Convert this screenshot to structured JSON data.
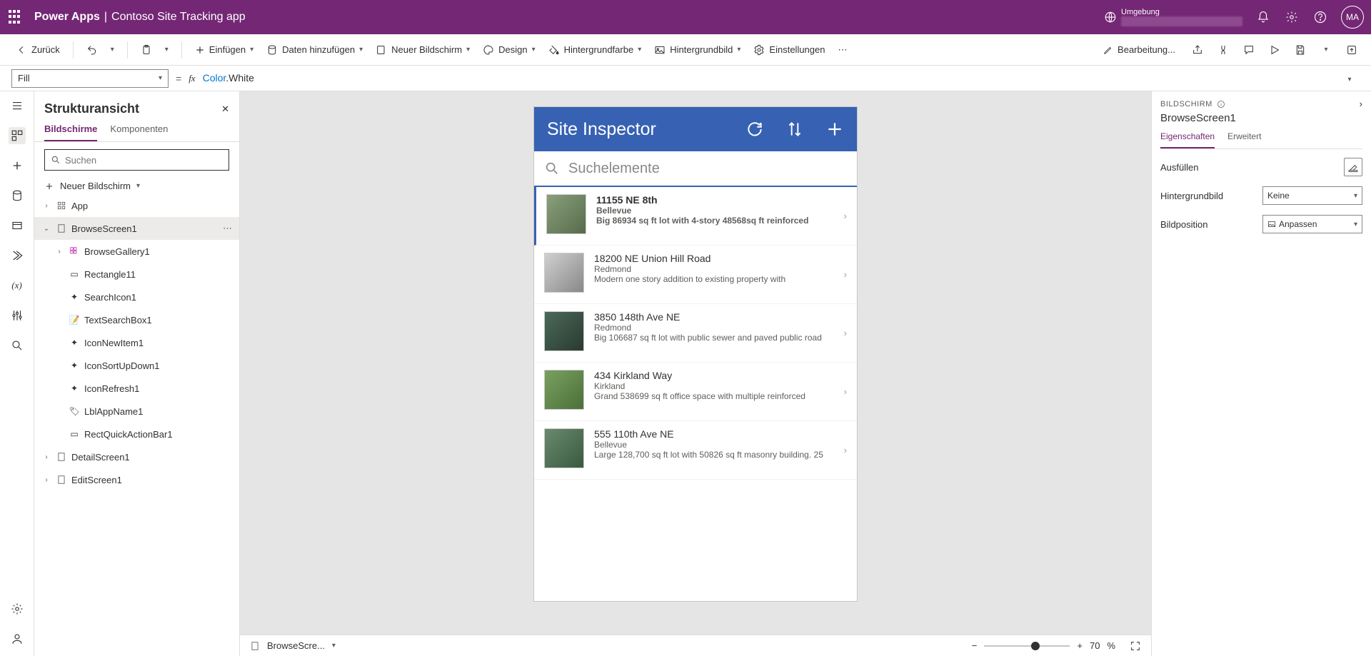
{
  "topbar": {
    "brand": "Power Apps",
    "app_name": "Contoso Site Tracking app",
    "env_label": "Umgebung",
    "avatar": "MA"
  },
  "cmdbar": {
    "back": "Zurück",
    "insert": "Einfügen",
    "add_data": "Daten hinzufügen",
    "new_screen": "Neuer Bildschirm",
    "design": "Design",
    "bg_color": "Hintergrundfarbe",
    "bg_image": "Hintergrundbild",
    "settings": "Einstellungen",
    "editing": "Bearbeitung..."
  },
  "formula": {
    "property": "Fill",
    "namespace": "Color",
    "value": ".White"
  },
  "tree": {
    "title": "Strukturansicht",
    "tab_screens": "Bildschirme",
    "tab_components": "Komponenten",
    "search_placeholder": "Suchen",
    "new_screen": "Neuer Bildschirm",
    "app": "App",
    "browse_screen": "BrowseScreen1",
    "children": [
      "BrowseGallery1",
      "Rectangle11",
      "SearchIcon1",
      "TextSearchBox1",
      "IconNewItem1",
      "IconSortUpDown1",
      "IconRefresh1",
      "LblAppName1",
      "RectQuickActionBar1"
    ],
    "detail_screen": "DetailScreen1",
    "edit_screen": "EditScreen1"
  },
  "canvas": {
    "app_title": "Site Inspector",
    "search_placeholder": "Suchelemente",
    "items": [
      {
        "title": "11155 NE 8th",
        "city": "Bellevue",
        "desc": "Big 86934 sq ft lot with 4-story 48568sq ft reinforced",
        "bold": true
      },
      {
        "title": "18200 NE Union Hill Road",
        "city": "Redmond",
        "desc": "Modern one story addition to existing property with"
      },
      {
        "title": "3850 148th Ave NE",
        "city": "Redmond",
        "desc": "Big 106687 sq ft lot with public sewer and paved public road"
      },
      {
        "title": "434 Kirkland Way",
        "city": "Kirkland",
        "desc": "Grand 538699 sq ft office space with multiple reinforced"
      },
      {
        "title": "555 110th Ave NE",
        "city": "Bellevue",
        "desc": "Large 128,700 sq ft lot with 50826 sq ft masonry building. 25"
      }
    ]
  },
  "bottom": {
    "breadcrumb": "BrowseScre...",
    "zoom_value": "70",
    "zoom_pct": "%"
  },
  "prop": {
    "heading": "BILDSCHIRM",
    "name": "BrowseScreen1",
    "tab_props": "Eigenschaften",
    "tab_adv": "Erweitert",
    "fill": "Ausfüllen",
    "bg_image": "Hintergrundbild",
    "bg_image_val": "Keine",
    "img_pos": "Bildposition",
    "img_pos_val": "Anpassen"
  }
}
